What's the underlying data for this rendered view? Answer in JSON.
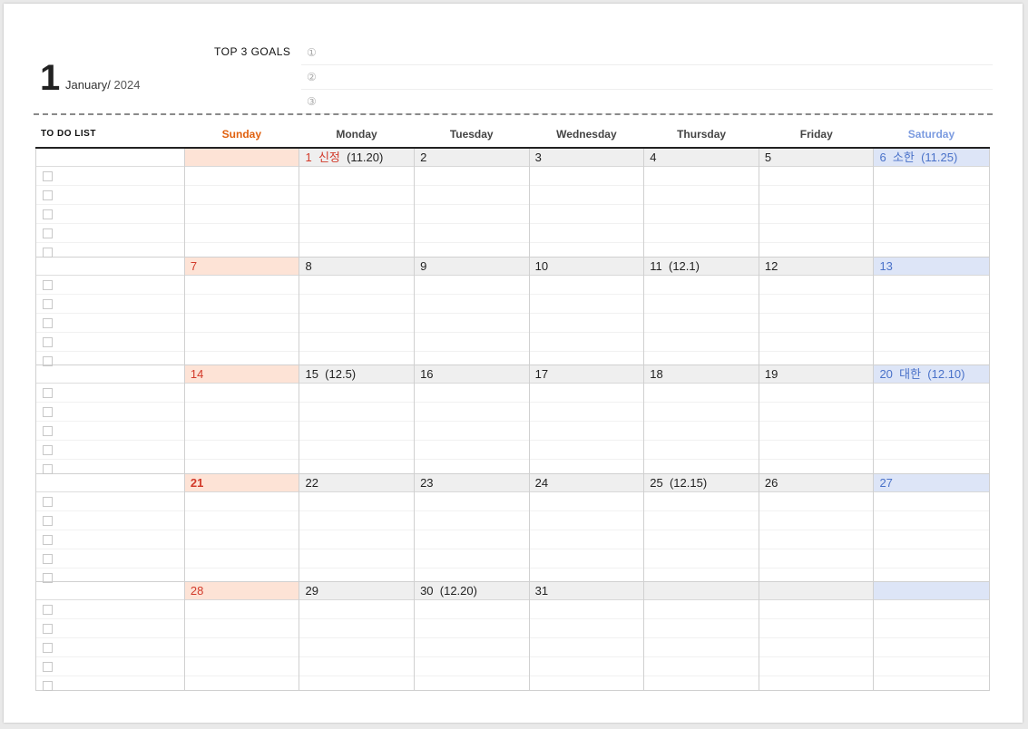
{
  "header": {
    "month_number": "1",
    "month_name": "January/",
    "year": "2024",
    "goals_label": "TOP 3 GOALS",
    "goal_markers": [
      "①",
      "②",
      "③"
    ]
  },
  "columns": {
    "todo_label": "TO DO LIST",
    "days": [
      "Sunday",
      "Monday",
      "Tuesday",
      "Wednesday",
      "Thursday",
      "Friday",
      "Saturday"
    ]
  },
  "weeks": [
    {
      "days": [
        {
          "num": "",
          "holiday": "",
          "lunar": ""
        },
        {
          "num": "1",
          "holiday": "신정",
          "lunar": "(11.20)"
        },
        {
          "num": "2",
          "holiday": "",
          "lunar": ""
        },
        {
          "num": "3",
          "holiday": "",
          "lunar": ""
        },
        {
          "num": "4",
          "holiday": "",
          "lunar": ""
        },
        {
          "num": "5",
          "holiday": "",
          "lunar": ""
        },
        {
          "num": "6",
          "holiday": "소한",
          "lunar": "(11.25)"
        }
      ]
    },
    {
      "days": [
        {
          "num": "7",
          "holiday": "",
          "lunar": ""
        },
        {
          "num": "8",
          "holiday": "",
          "lunar": ""
        },
        {
          "num": "9",
          "holiday": "",
          "lunar": ""
        },
        {
          "num": "10",
          "holiday": "",
          "lunar": ""
        },
        {
          "num": "11",
          "holiday": "",
          "lunar": "(12.1)"
        },
        {
          "num": "12",
          "holiday": "",
          "lunar": ""
        },
        {
          "num": "13",
          "holiday": "",
          "lunar": ""
        }
      ]
    },
    {
      "days": [
        {
          "num": "14",
          "holiday": "",
          "lunar": ""
        },
        {
          "num": "15",
          "holiday": "",
          "lunar": "(12.5)"
        },
        {
          "num": "16",
          "holiday": "",
          "lunar": ""
        },
        {
          "num": "17",
          "holiday": "",
          "lunar": ""
        },
        {
          "num": "18",
          "holiday": "",
          "lunar": ""
        },
        {
          "num": "19",
          "holiday": "",
          "lunar": ""
        },
        {
          "num": "20",
          "holiday": "대한",
          "lunar": "(12.10)"
        }
      ]
    },
    {
      "days": [
        {
          "num": "21",
          "holiday": "",
          "lunar": "",
          "bold": true
        },
        {
          "num": "22",
          "holiday": "",
          "lunar": ""
        },
        {
          "num": "23",
          "holiday": "",
          "lunar": ""
        },
        {
          "num": "24",
          "holiday": "",
          "lunar": ""
        },
        {
          "num": "25",
          "holiday": "",
          "lunar": "(12.15)"
        },
        {
          "num": "26",
          "holiday": "",
          "lunar": ""
        },
        {
          "num": "27",
          "holiday": "",
          "lunar": ""
        }
      ]
    },
    {
      "days": [
        {
          "num": "28",
          "holiday": "",
          "lunar": ""
        },
        {
          "num": "29",
          "holiday": "",
          "lunar": ""
        },
        {
          "num": "30",
          "holiday": "",
          "lunar": "(12.20)"
        },
        {
          "num": "31",
          "holiday": "",
          "lunar": ""
        },
        {
          "num": "",
          "holiday": "",
          "lunar": ""
        },
        {
          "num": "",
          "holiday": "",
          "lunar": ""
        },
        {
          "num": "",
          "holiday": "",
          "lunar": ""
        }
      ]
    }
  ],
  "colors": {
    "sunday_header": "#e0600e",
    "saturday_header": "#7b9be0",
    "sunday_fill": "#fde3d6",
    "saturday_fill": "#dde5f7",
    "holiday_red": "#d23a2a",
    "saturday_blue": "#4a72c9"
  }
}
